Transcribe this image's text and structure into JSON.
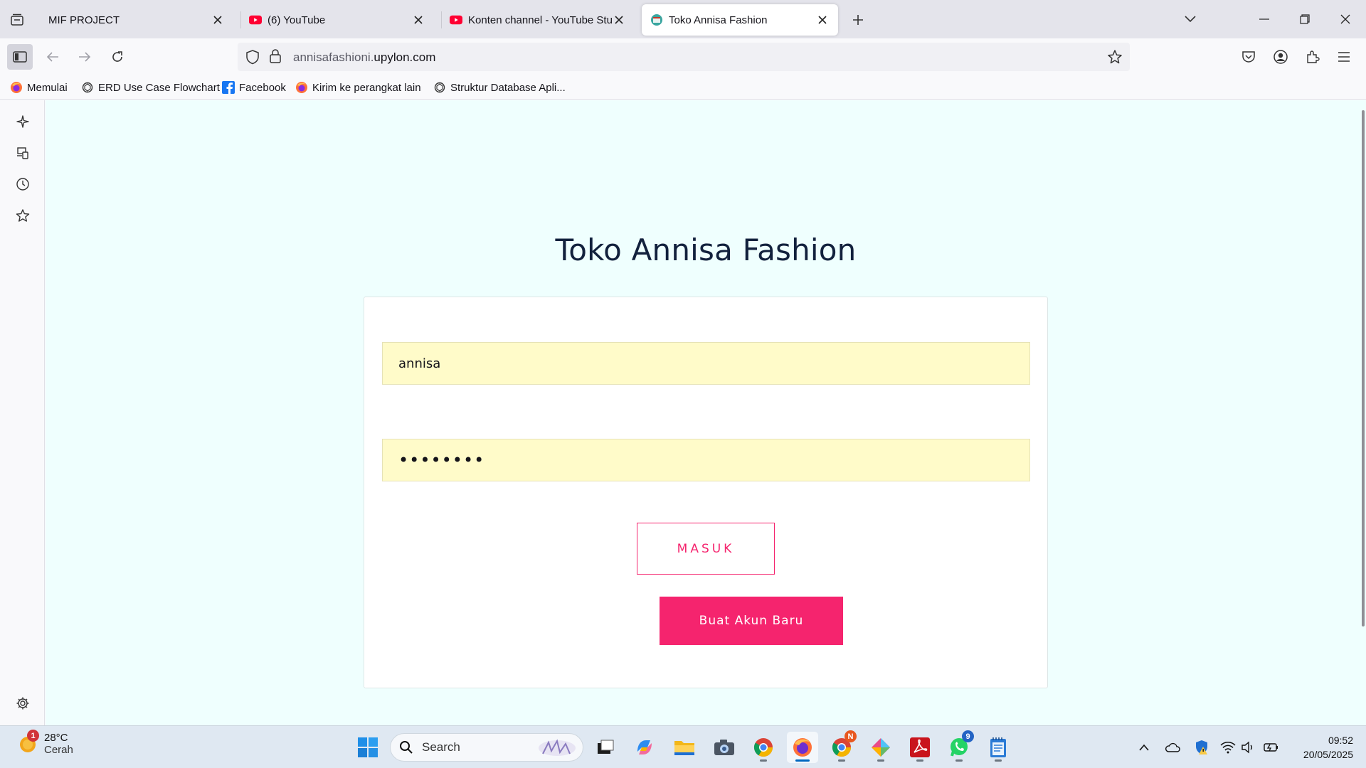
{
  "browser": {
    "tabs": [
      {
        "title": "MIF PROJECT",
        "icon": "folder-icon"
      },
      {
        "title": "(6) YouTube",
        "icon": "youtube-icon"
      },
      {
        "title": "Konten channel - YouTube Studi",
        "icon": "youtube-icon"
      },
      {
        "title": "Toko Annisa Fashion",
        "icon": "site-icon",
        "active": true
      }
    ],
    "url": {
      "prefix": "annisafashioni.",
      "domain": "upylon.com"
    },
    "bookmarks": [
      {
        "label": "Memulai",
        "icon": "firefox-icon"
      },
      {
        "label": "ERD Use Case Flowchart",
        "icon": "chatgpt-icon"
      },
      {
        "label": "Facebook",
        "icon": "facebook-icon"
      },
      {
        "label": "Kirim ke perangkat lain",
        "icon": "firefox-icon"
      },
      {
        "label": "Struktur Database Apli...",
        "icon": "chatgpt-icon"
      }
    ]
  },
  "page": {
    "title": "Toko Annisa Fashion",
    "username_value": "annisa",
    "password_value": "••••••••",
    "login_button": "MASUK",
    "register_button": "Buat Akun Baru",
    "accent_color": "#f5246e",
    "background_color": "#effffe"
  },
  "taskbar": {
    "weather": {
      "temp": "28°C",
      "condition": "Cerah",
      "badge": "1"
    },
    "search_placeholder": "Search",
    "chrome_badge": "N",
    "whatsapp_badge": "9",
    "time": "09:52",
    "date": "20/05/2025"
  }
}
